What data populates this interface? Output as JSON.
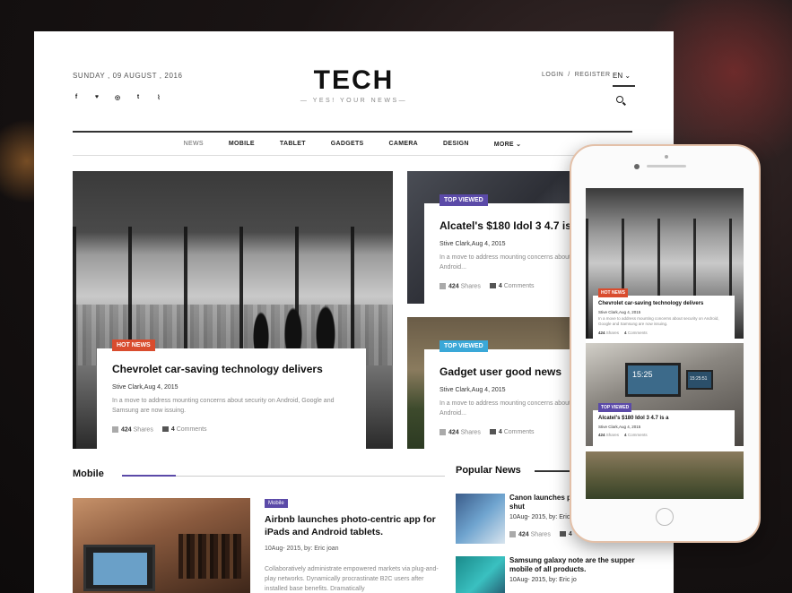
{
  "header": {
    "date": "SUNDAY , 09 AUGUST , 2016",
    "logo_title": "TECH",
    "logo_tagline": "YES! YOUR NEWS",
    "login": "LOGIN",
    "separator": "/",
    "register": "REGISTER",
    "language": "EN",
    "social_icons": [
      "facebook-icon",
      "twitter-icon",
      "instagram-icon",
      "tumblr-icon",
      "rss-icon"
    ],
    "social_glyphs": [
      "f",
      "♥",
      "◎",
      "t",
      "⌇"
    ]
  },
  "nav": {
    "items": [
      "NEWS",
      "MOBILE",
      "TABLET",
      "GADGETS",
      "CAMERA",
      "DESIGN",
      "MORE"
    ],
    "more_caret": "⌄"
  },
  "hero": {
    "badge": "HOT NEWS",
    "title": "Chevrolet car-saving technology delivers",
    "meta": "Stive Clark,Aug 4, 2015",
    "excerpt": "In a move to address mounting concerns about security on Android, Google and Samsung are now issuing.",
    "shares_count": "424",
    "shares_label": "Shares",
    "comments_count": "4",
    "comments_label": "Comments"
  },
  "side1": {
    "badge": "TOP VIEWED",
    "title": "Alcatel's $180 Idol 3 4.7 is a",
    "meta": "Stive Clark,Aug 4, 2015",
    "excerpt": "In a move to address mounting concerns about security on Android...",
    "shares_count": "424",
    "shares_label": "Shares",
    "comments_count": "4",
    "comments_label": "Comments"
  },
  "side2": {
    "badge": "TOP VIEWED",
    "title": "Gadget user good news",
    "meta": "Stive Clark,Aug 4, 2015",
    "excerpt": "In a move to address mounting concerns about security on Android...",
    "shares_count": "424",
    "shares_label": "Shares",
    "comments_count": "4",
    "comments_label": "Comments"
  },
  "mobile_section": {
    "heading": "Mobile",
    "tag": "Mobile",
    "title": "Airbnb launches photo-centric app for iPads and Android tablets.",
    "meta": "10Aug- 2015, by: Eric joan",
    "excerpt": "Collaboratively administrate empowered markets via plug-and-play networks. Dynamically procrastinate B2C users after installed base benefits. Dramatically"
  },
  "popular_section": {
    "heading": "Popular News",
    "items": [
      {
        "title": "Canon launches ph Model supper shut",
        "meta": "10Aug- 2015, by: Eric jo",
        "shares_count": "424",
        "shares_label": "Shares",
        "comments_count": "4"
      },
      {
        "title": "Samsung galaxy note are the supper mobile of all products.",
        "meta": "10Aug- 2015, by: Eric jo"
      }
    ]
  },
  "phone": {
    "card1": {
      "badge": "HOT NEWS",
      "title": "Chevrolet car-saving technology delivers",
      "meta": "Stive Clark,Aug 4, 2015",
      "excerpt": "In a move to address mounting concerns about security on Android, Google and Samsung are now issuing.",
      "shares_count": "424",
      "shares_label": "Shares",
      "comments_count": "4",
      "comments_label": "Comments"
    },
    "card2": {
      "clock": "15:25",
      "clock_small": "15:25:51",
      "badge": "TOP VIEWED",
      "title": "Alcatel's $180 Idol 3 4.7 is a",
      "meta": "Stive Clark,Aug 4, 2015",
      "shares_count": "424",
      "shares_label": "Shares",
      "comments_count": "4",
      "comments_label": "Comments"
    }
  },
  "colors": {
    "hot_news": "#d94c2e",
    "top_viewed": "#3aa8d8",
    "accent_purple": "#5b4aa8"
  }
}
